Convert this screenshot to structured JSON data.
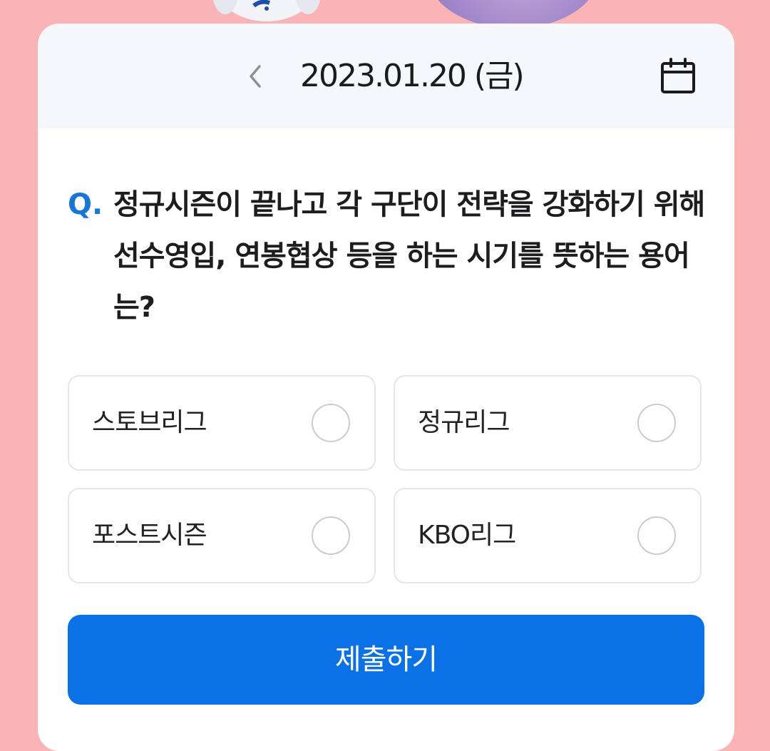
{
  "header": {
    "date": "2023.01.20 (금)",
    "prev_icon": "chevron-left-icon",
    "calendar_icon": "calendar-icon"
  },
  "quiz": {
    "prefix": "Q.",
    "question": "정규시즌이 끝나고 각 구단이 전략을 강화하기 위해 선수영입, 연봉협상 등을 하는 시기를 뜻하는 용어는?",
    "options": [
      {
        "label": "스토브리그",
        "selected": false
      },
      {
        "label": "정규리그",
        "selected": false
      },
      {
        "label": "포스트시즌",
        "selected": false
      },
      {
        "label": "KBO리그",
        "selected": false
      }
    ]
  },
  "submit_label": "제출하기",
  "colors": {
    "background": "#fbb4b6",
    "accent": "#0a72e6",
    "question_prefix": "#1777d8"
  }
}
